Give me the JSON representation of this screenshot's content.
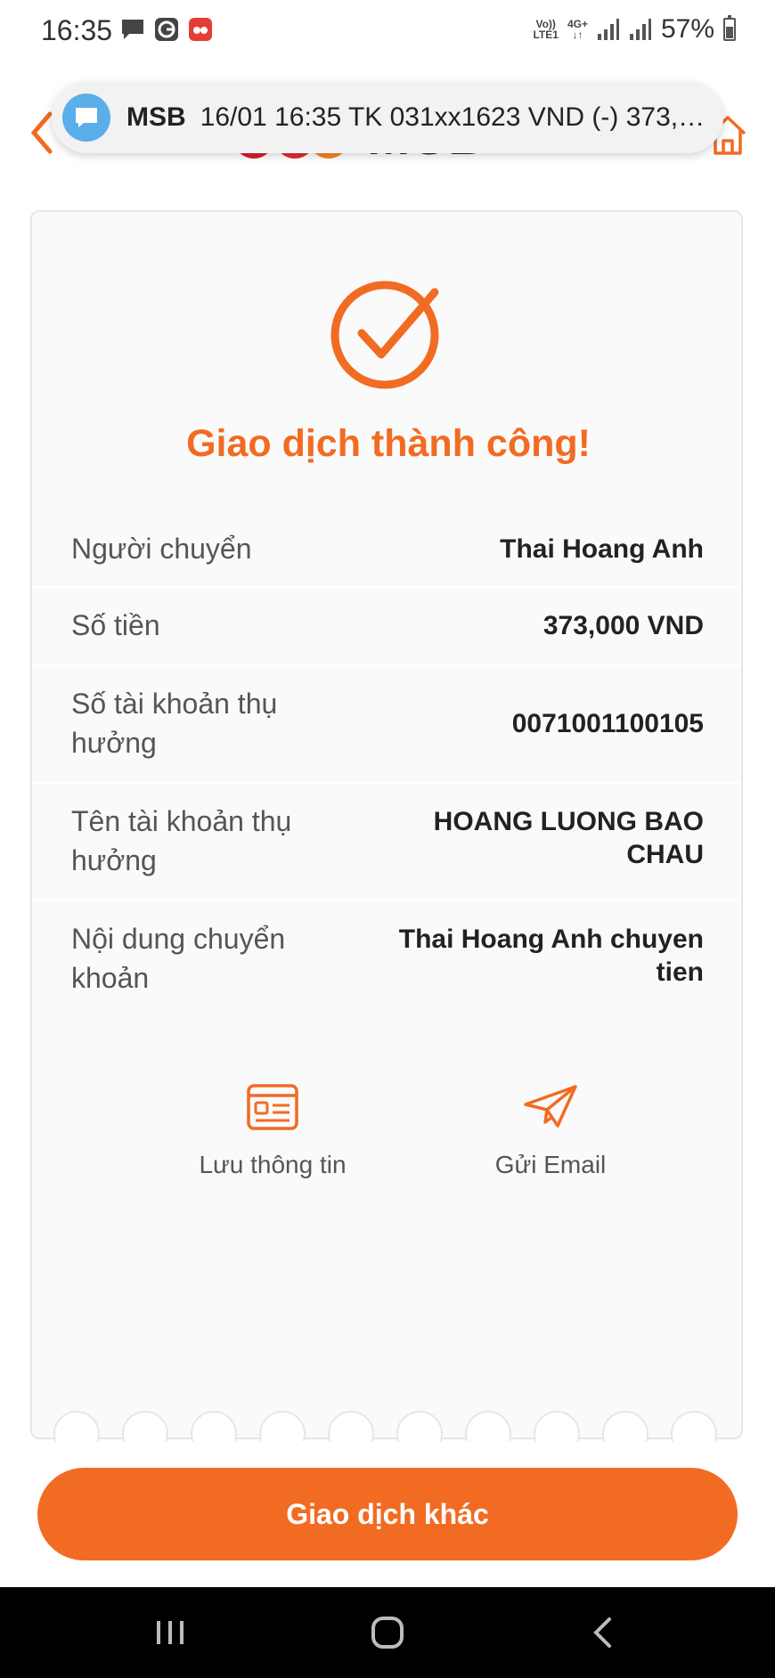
{
  "status_bar": {
    "time": "16:35",
    "notification_icons": [
      "chat-bubble-icon",
      "g-app-icon",
      "red-app-icon"
    ],
    "network_top": "Vo))",
    "network_bottom": "LTE1",
    "data_type": "4G+",
    "battery_level": 0.57,
    "battery": "57%"
  },
  "notification": {
    "sender": "MSB",
    "text": "16/01 16:35 TK 031xx1623 VND (-) 373,0..."
  },
  "header": {
    "back_icon": "chevron-left-icon",
    "home_icon": "home-icon",
    "logo_text": "MSB",
    "colors": {
      "accent": "#f26b22"
    }
  },
  "result": {
    "title": "Giao dịch thành công!",
    "status_icon": "check-circle-icon"
  },
  "details": [
    {
      "label": "Người chuyển",
      "value": "Thai Hoang Anh"
    },
    {
      "label": "Số tiền",
      "value": "373,000 VND"
    },
    {
      "label": "Số tài khoản thụ hưởng",
      "value": "0071001100105"
    },
    {
      "label": "Tên tài khoản thụ hưởng",
      "value": "HOANG LUONG BAO CHAU"
    },
    {
      "label": "Nội dung chuyển khoản",
      "value": "Thai Hoang Anh chuyen tien"
    }
  ],
  "actions": {
    "save": {
      "label": "Lưu thông tin",
      "icon": "id-card-icon"
    },
    "email": {
      "label": "Gửi Email",
      "icon": "paper-plane-icon"
    }
  },
  "cta": {
    "label": "Giao dịch khác"
  },
  "navbar": {
    "recents_icon": "recents-icon",
    "home_icon": "home-circle-icon",
    "back_icon": "back-chevron-icon"
  }
}
